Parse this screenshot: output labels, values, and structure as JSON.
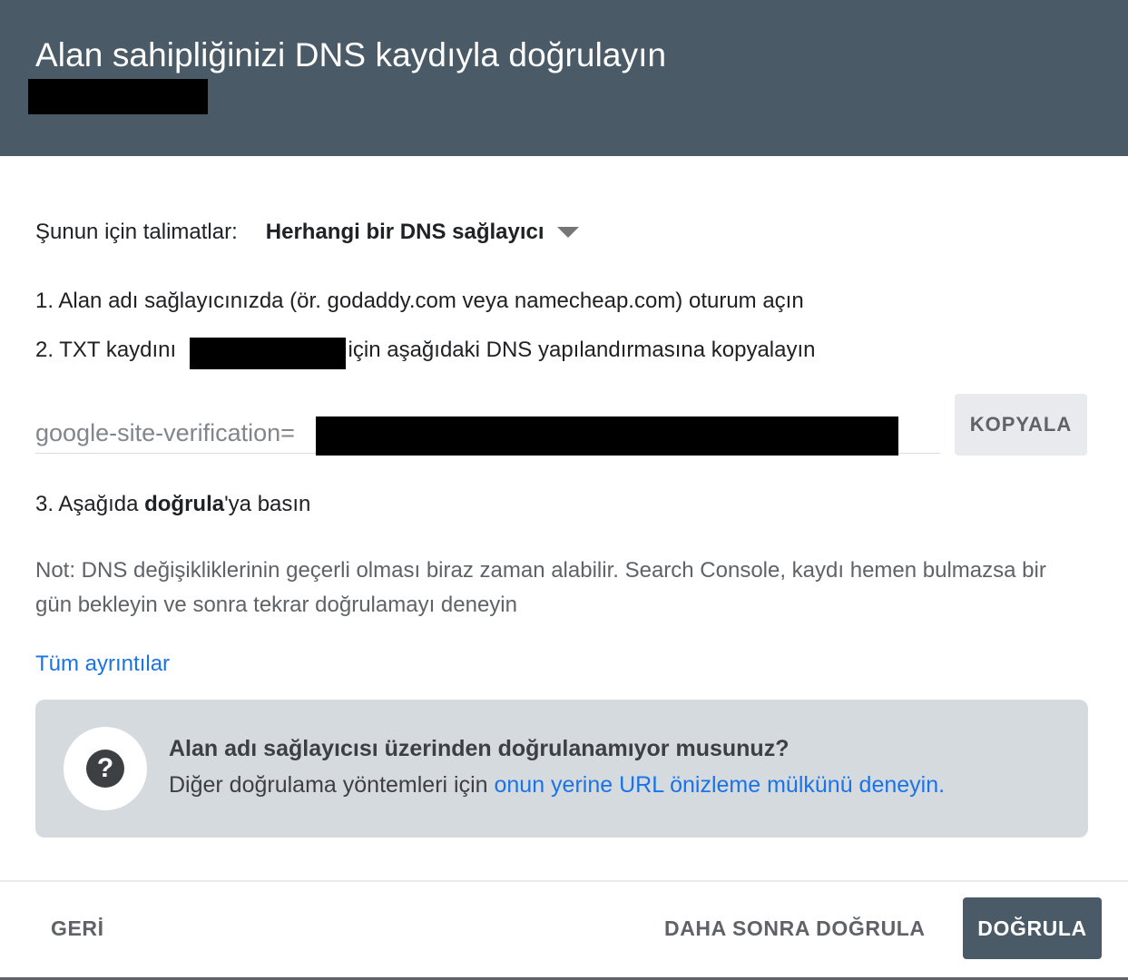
{
  "dialog": {
    "title": "Alan sahipliğinizi DNS kaydıyla doğrulayın"
  },
  "instructions": {
    "label": "Şunun için talimatlar:",
    "provider_selected": "Herhangi bir DNS sağlayıcı"
  },
  "steps": {
    "step1": "1. Alan adı sağlayıcınızda (ör. godaddy.com veya namecheap.com) oturum açın",
    "step2_before": "2. TXT kaydını",
    "step2_after": "için aşağıdaki DNS yapılandırmasına kopyalayın",
    "step3_before": "3. Aşağıda ",
    "step3_bold": "doğrula",
    "step3_after": "'ya basın"
  },
  "txt_record": {
    "value_prefix": "google-site-verification="
  },
  "copy_button": {
    "label": "KOPYALA"
  },
  "note": "Not: DNS değişikliklerinin geçerli olması biraz zaman alabilir. Search Console, kaydı hemen bulmazsa bir gün bekleyin ve sonra tekrar doğrulamayı deneyin",
  "details_link": "Tüm ayrıntılar",
  "info_box": {
    "title": "Alan adı sağlayıcısı üzerinden doğrulanamıyor musunuz?",
    "text_before": "Diğer doğrulama yöntemleri için ",
    "link": "onun yerine URL önizleme mülkünü deneyin."
  },
  "footer": {
    "back_label": "GERİ",
    "later_label": "DAHA SONRA DOĞRULA",
    "verify_label": "DOĞRULA"
  },
  "colors": {
    "header_bg": "#4a5a66",
    "link": "#1a73e8",
    "info_box_bg": "#d5dadf",
    "primary_button": "#4a5a66"
  }
}
